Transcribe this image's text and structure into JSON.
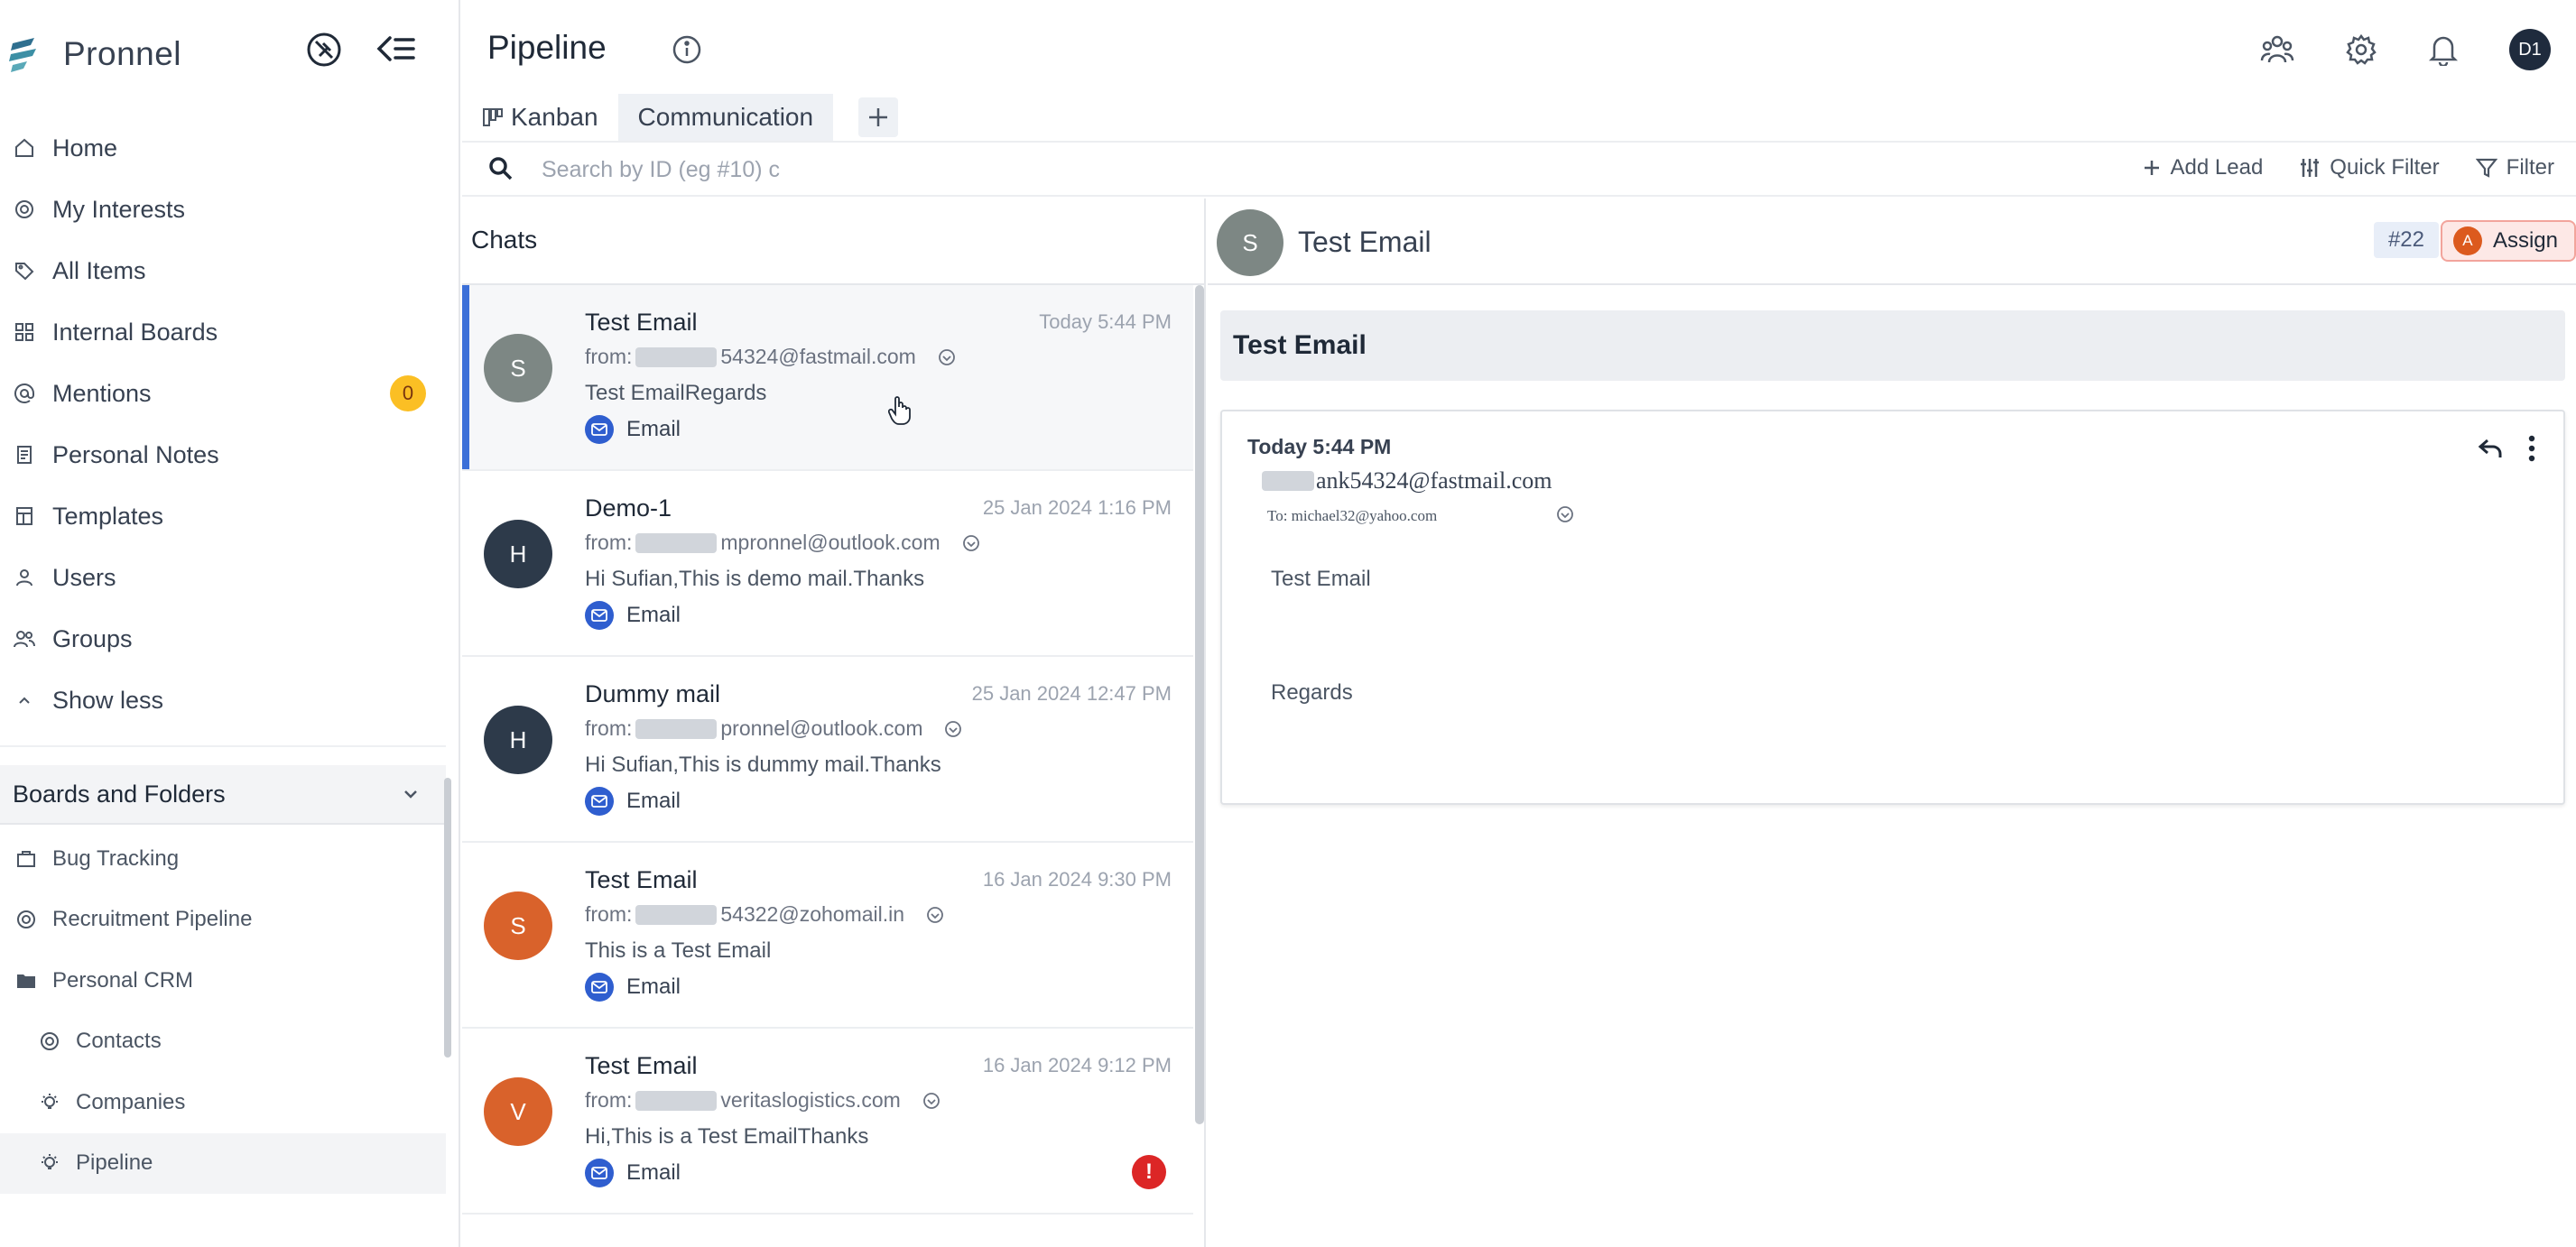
{
  "app": {
    "name": "Pronnel"
  },
  "sidebar": {
    "nav": [
      {
        "label": "Home",
        "icon": "home-icon"
      },
      {
        "label": "My Interests",
        "icon": "target-icon"
      },
      {
        "label": "All Items",
        "icon": "tag-icon"
      },
      {
        "label": "Internal Boards",
        "icon": "grid-icon"
      },
      {
        "label": "Mentions",
        "icon": "at-icon",
        "badge": "0"
      },
      {
        "label": "Personal Notes",
        "icon": "note-icon"
      },
      {
        "label": "Templates",
        "icon": "template-icon"
      },
      {
        "label": "Users",
        "icon": "user-icon"
      },
      {
        "label": "Groups",
        "icon": "users-icon"
      },
      {
        "label": "Show less",
        "icon": "chevron-up-icon"
      }
    ],
    "boards_header": "Boards and Folders",
    "boards": [
      {
        "label": "Bug Tracking",
        "icon": "board-icon"
      },
      {
        "label": "Recruitment Pipeline",
        "icon": "target-icon"
      },
      {
        "label": "Personal CRM",
        "icon": "folder-icon"
      },
      {
        "label": "Contacts",
        "icon": "target-icon"
      },
      {
        "label": "Companies",
        "icon": "bulb-icon"
      },
      {
        "label": "Pipeline",
        "icon": "bulb-icon"
      }
    ]
  },
  "header": {
    "title": "Pipeline"
  },
  "user": {
    "initials": "D1"
  },
  "tabs": [
    {
      "label": "Kanban"
    },
    {
      "label": "Communication"
    }
  ],
  "search": {
    "placeholder": "Search by ID (eg #10) c"
  },
  "toolbar": {
    "add_lead": "Add Lead",
    "quick_filter": "Quick Filter",
    "filter": "Filter"
  },
  "chats": {
    "title": "Chats",
    "items": [
      {
        "initial": "S",
        "color": "#7d8784",
        "subject": "Test Email",
        "time": "Today 5:44 PM",
        "from_prefix": "from:",
        "from_suffix": "54324@fastmail.com",
        "preview": "Test EmailRegards",
        "channel": "Email",
        "alert": false
      },
      {
        "initial": "H",
        "color": "#2d3a4a",
        "subject": "Demo-1",
        "time": "25 Jan 2024 1:16 PM",
        "from_prefix": "from:",
        "from_suffix": "mpronnel@outlook.com",
        "preview": "Hi Sufian,This is demo mail.Thanks",
        "channel": "Email",
        "alert": false
      },
      {
        "initial": "H",
        "color": "#2d3a4a",
        "subject": "Dummy mail",
        "time": "25 Jan 2024 12:47 PM",
        "from_prefix": "from:",
        "from_suffix": "pronnel@outlook.com",
        "preview": "Hi Sufian,This is dummy mail.Thanks",
        "channel": "Email",
        "alert": false
      },
      {
        "initial": "S",
        "color": "#d9622b",
        "subject": "Test Email",
        "time": "16 Jan 2024 9:30 PM",
        "from_prefix": "from:",
        "from_suffix": "54322@zohomail.in",
        "preview": "This is a Test Email",
        "channel": "Email",
        "alert": false
      },
      {
        "initial": "V",
        "color": "#d9622b",
        "subject": "Test Email",
        "time": "16 Jan 2024 9:12 PM",
        "from_prefix": "from:",
        "from_suffix": "veritaslogistics.com",
        "preview": "Hi,This is a Test EmailThanks",
        "channel": "Email",
        "alert": true,
        "alert_text": "!"
      }
    ]
  },
  "conversation": {
    "initial": "S",
    "title": "Test Email",
    "id": "#22",
    "assign_initial": "A",
    "assign_label": "Assign",
    "subject": "Test Email",
    "message": {
      "time": "Today 5:44 PM",
      "from_suffix": "ank54324@fastmail.com",
      "to": "To: michael32@yahoo.com",
      "body_line1": "Test Email",
      "body_line2": "Regards"
    }
  }
}
